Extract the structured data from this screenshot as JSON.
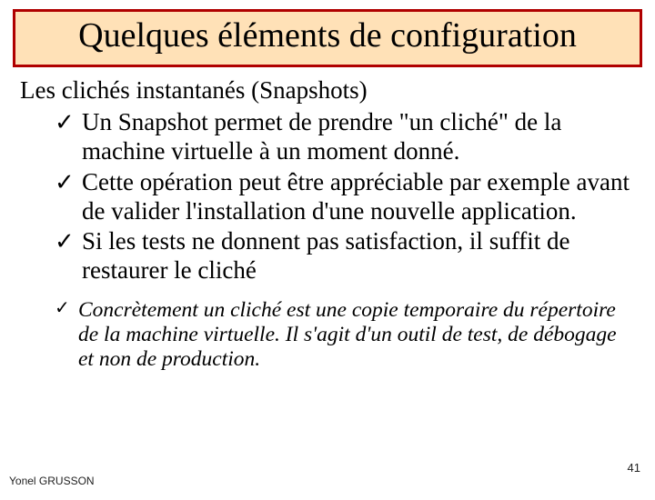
{
  "title": "Quelques éléments de configuration",
  "intro": "Les clichés instantanés (Snapshots)",
  "bullets": [
    "Un Snapshot permet de prendre \"un cliché\" de la machine virtuelle à un moment donné.",
    "Cette opération peut être appréciable par exemple avant de valider l'installation d'une nouvelle application.",
    "Si les tests ne donnent pas satisfaction, il suffit de restaurer le cliché"
  ],
  "italic_note": "Concrètement un cliché est une copie temporaire du répertoire de la machine virtuelle. Il s'agit d'un outil de test, de débogage et non de production.",
  "check_glyph": "✓",
  "footer": {
    "author": "Yonel GRUSSON",
    "page": "41"
  }
}
